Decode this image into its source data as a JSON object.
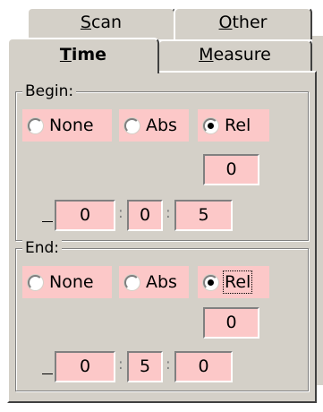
{
  "tabs": {
    "back_row": [
      {
        "label": "Scan",
        "mnemonic": "S",
        "rest": "can"
      },
      {
        "label": "Other",
        "mnemonic": "O",
        "rest": "ther"
      }
    ],
    "front_row": [
      {
        "label": "Time",
        "mnemonic": "T",
        "rest": "ime",
        "active": true
      },
      {
        "label": "Measure",
        "mnemonic": "M",
        "rest": "easure",
        "active": false
      }
    ]
  },
  "begin": {
    "legend": "Begin:",
    "options": [
      "None",
      "Abs",
      "Rel"
    ],
    "selected": "Rel",
    "single_value": "0",
    "time": [
      "0",
      "0",
      "5"
    ]
  },
  "end": {
    "legend": "End:",
    "options": [
      "None",
      "Abs",
      "Rel"
    ],
    "selected": "Rel",
    "single_value": "0",
    "time": [
      "0",
      "5",
      "0"
    ]
  },
  "separator": ":",
  "colors": {
    "field_bg": "#fcc8c8",
    "panel_bg": "#d4d0c8"
  }
}
